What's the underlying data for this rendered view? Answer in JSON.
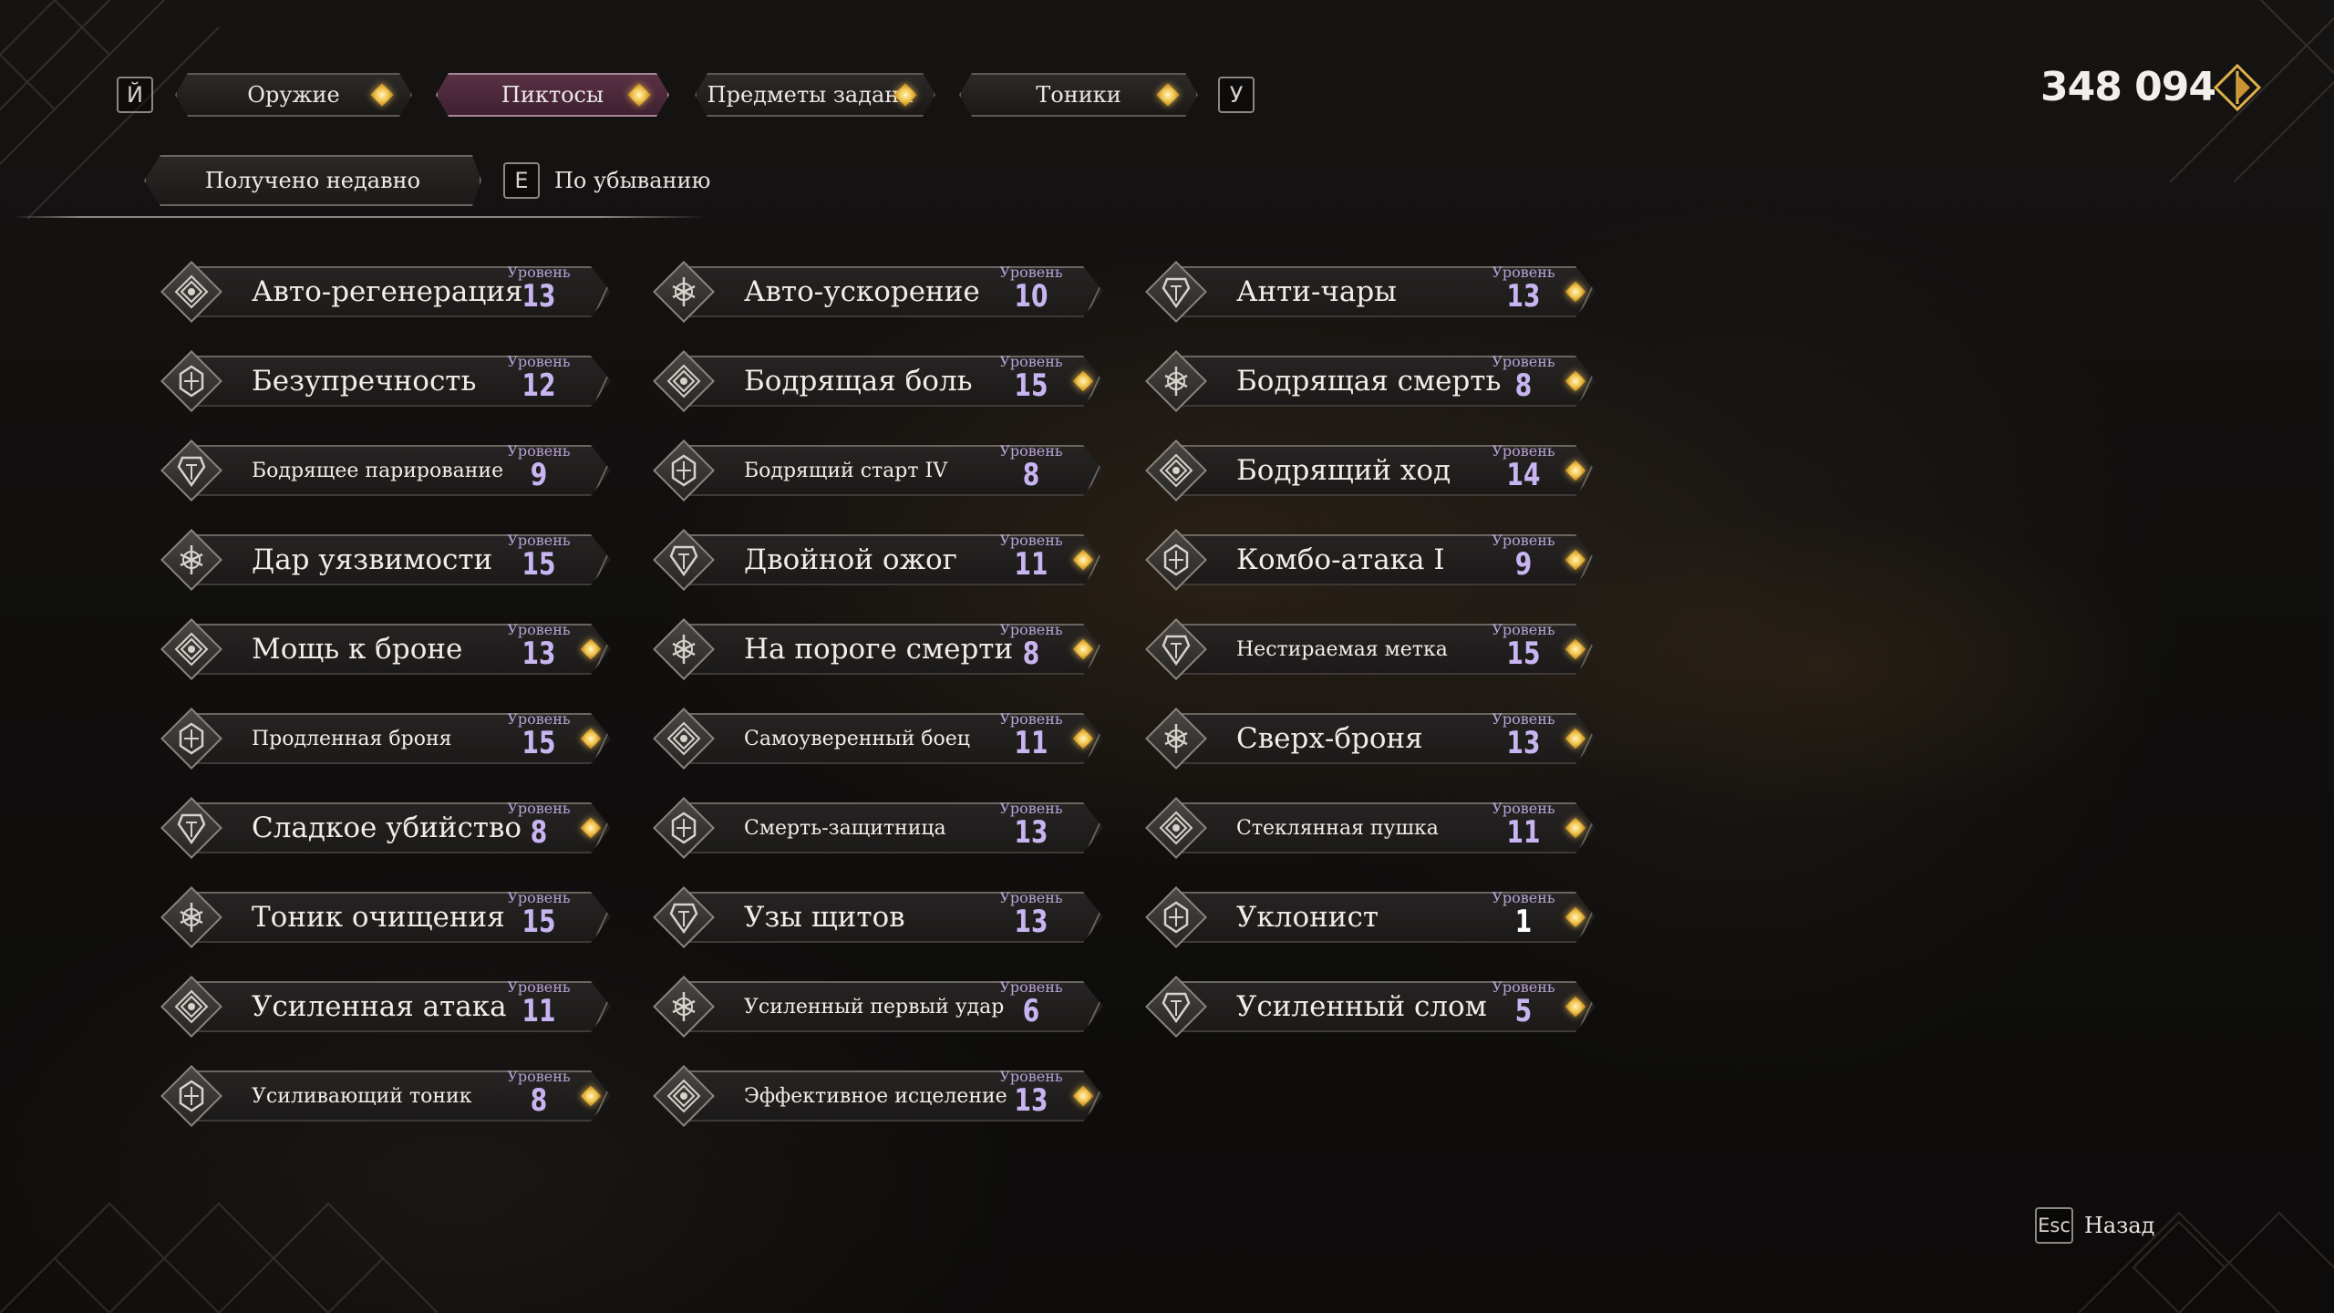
{
  "tabs": {
    "prev_key": "Й",
    "next_key": "У",
    "items": [
      {
        "label": "Оружие",
        "active": false
      },
      {
        "label": "Пиктосы",
        "active": true
      },
      {
        "label": "Предметы задани",
        "active": false
      },
      {
        "label": "Тоники",
        "active": false
      }
    ]
  },
  "currency": {
    "amount": "348 094",
    "icon": "chroma-icon"
  },
  "sort": {
    "current": "Получено недавно",
    "order_key": "E",
    "order_label": "По убыванию"
  },
  "level_label": "Уровень",
  "pictos": [
    {
      "name": "Авто-регенерация",
      "level": "13",
      "new": false,
      "small": false
    },
    {
      "name": "Авто-ускорение",
      "level": "10",
      "new": false,
      "small": false
    },
    {
      "name": "Анти-чары",
      "level": "13",
      "new": true,
      "small": false
    },
    {
      "name": "Безупречность",
      "level": "12",
      "new": false,
      "small": false
    },
    {
      "name": "Бодрящая боль",
      "level": "15",
      "new": true,
      "small": false
    },
    {
      "name": "Бодрящая смерть",
      "level": "8",
      "new": true,
      "small": false
    },
    {
      "name": "Бодрящее парирование",
      "level": "9",
      "new": false,
      "small": true
    },
    {
      "name": "Бодрящий старт IV",
      "level": "8",
      "new": false,
      "small": true
    },
    {
      "name": "Бодрящий ход",
      "level": "14",
      "new": true,
      "small": false
    },
    {
      "name": "Дар уязвимости",
      "level": "15",
      "new": false,
      "small": false
    },
    {
      "name": "Двойной ожог",
      "level": "11",
      "new": true,
      "small": false
    },
    {
      "name": "Комбо-атака I",
      "level": "9",
      "new": true,
      "small": false
    },
    {
      "name": "Мощь к броне",
      "level": "13",
      "new": true,
      "small": false
    },
    {
      "name": "На пороге смерти",
      "level": "8",
      "new": true,
      "small": false
    },
    {
      "name": "Нестираемая метка",
      "level": "15",
      "new": true,
      "small": true
    },
    {
      "name": "Продленная броня",
      "level": "15",
      "new": true,
      "small": true
    },
    {
      "name": "Самоуверенный боец",
      "level": "11",
      "new": true,
      "small": true
    },
    {
      "name": "Сверх-броня",
      "level": "13",
      "new": true,
      "small": false
    },
    {
      "name": "Сладкое убийство",
      "level": "8",
      "new": true,
      "small": false
    },
    {
      "name": "Смерть-защитница",
      "level": "13",
      "new": false,
      "small": true
    },
    {
      "name": "Стеклянная пушка",
      "level": "11",
      "new": true,
      "small": true
    },
    {
      "name": "Тоник очищения",
      "level": "15",
      "new": false,
      "small": false
    },
    {
      "name": "Узы щитов",
      "level": "13",
      "new": false,
      "small": false
    },
    {
      "name": "Уклонист",
      "level": "1",
      "new": true,
      "small": false
    },
    {
      "name": "Усиленная атака",
      "level": "11",
      "new": false,
      "small": false
    },
    {
      "name": "Усиленный первый удар",
      "level": "6",
      "new": false,
      "small": true
    },
    {
      "name": "Усиленный слом",
      "level": "5",
      "new": true,
      "small": false
    },
    {
      "name": "Усиливающий тоник",
      "level": "8",
      "new": true,
      "small": true
    },
    {
      "name": "Эффективное исцеление",
      "level": "13",
      "new": true,
      "small": true
    }
  ],
  "footer": {
    "back_key": "Esc",
    "back_label": "Назад"
  },
  "colors": {
    "accent_tab": "#4a283a",
    "level": "#c8b4f0",
    "gem": "#f0c24a"
  }
}
